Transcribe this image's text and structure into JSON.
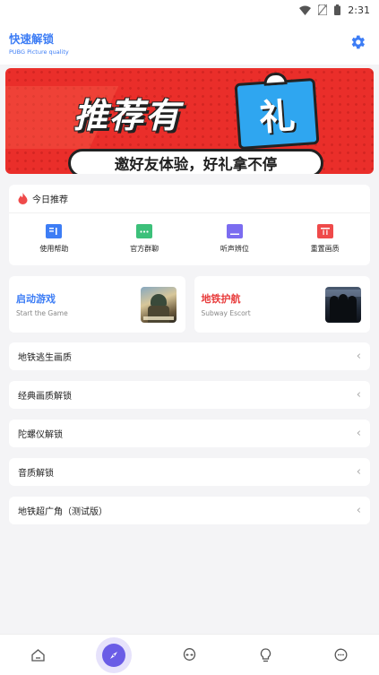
{
  "status": {
    "time": "2:31"
  },
  "app": {
    "title": "快速解锁",
    "subtitle": "PUBG Picture quality"
  },
  "banner": {
    "title": "推荐有",
    "badge": "礼",
    "slogan": "邀好友体验，好礼拿不停"
  },
  "recommend": {
    "title": "今日推荐",
    "items": [
      {
        "label": "使用帮助",
        "color": "#3d7df5"
      },
      {
        "label": "官方群聊",
        "color": "#3cc07a"
      },
      {
        "label": "听声辨位",
        "color": "#7b6cf0"
      },
      {
        "label": "重置画质",
        "color": "#ef4a4a"
      }
    ]
  },
  "games": [
    {
      "title": "启动游戏",
      "subtitle": "Start the Game",
      "color": "#3d7df5"
    },
    {
      "title": "地铁护航",
      "subtitle": "Subway Escort",
      "color": "#e83c3c"
    }
  ],
  "list": [
    {
      "label": "地铁逃生画质"
    },
    {
      "label": "经典画质解锁"
    },
    {
      "label": "陀螺仪解锁"
    },
    {
      "label": "音质解锁"
    },
    {
      "label": "地铁超广角（测试版）"
    }
  ],
  "tabs": [
    "home",
    "discover",
    "alien",
    "bulb",
    "chat"
  ],
  "colors": {
    "accent": "#3d7df5",
    "nav_active": "#6a5ce6",
    "banner_red": "#ea2e2a"
  }
}
